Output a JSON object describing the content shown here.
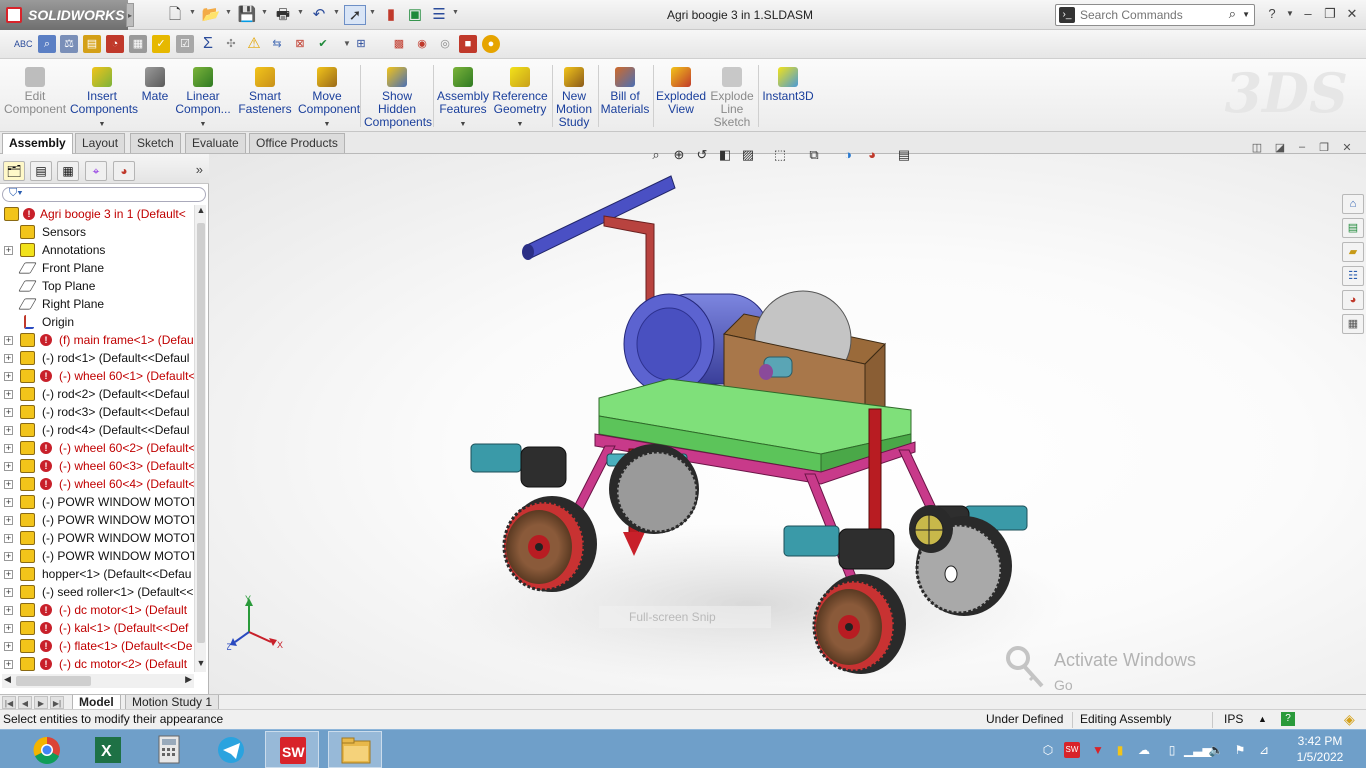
{
  "app": {
    "brand": "SOLIDWORKS",
    "document_title": "Agri boogie 3 in 1.SLDASM"
  },
  "search": {
    "placeholder": "Search Commands"
  },
  "command_manager": {
    "commands": [
      {
        "label": "Edit Component",
        "disabled": true
      },
      {
        "label": "Insert Components"
      },
      {
        "label": "Mate"
      },
      {
        "label": "Linear Compon..."
      },
      {
        "label": "Smart Fasteners"
      },
      {
        "label": "Move Component"
      },
      {
        "label": "Show Hidden Components"
      },
      {
        "label": "Assembly Features"
      },
      {
        "label": "Reference Geometry"
      },
      {
        "label": "New Motion Study"
      },
      {
        "label": "Bill of Materials"
      },
      {
        "label": "Exploded View"
      },
      {
        "label": "Explode Line Sketch",
        "disabled": true
      },
      {
        "label": "Instant3D"
      }
    ],
    "tabs": [
      "Assembly",
      "Layout",
      "Sketch",
      "Evaluate",
      "Office Products"
    ],
    "active_tab": "Assembly"
  },
  "feature_tree": {
    "items": [
      {
        "label": "Agri boogie 3 in 1  (Default<",
        "type": "root",
        "error": true
      },
      {
        "label": "Sensors",
        "type": "folder"
      },
      {
        "label": "Annotations",
        "type": "annotation",
        "expandable": true
      },
      {
        "label": "Front Plane",
        "type": "plane"
      },
      {
        "label": "Top Plane",
        "type": "plane"
      },
      {
        "label": "Right Plane",
        "type": "plane"
      },
      {
        "label": "Origin",
        "type": "origin"
      },
      {
        "label": "(f) main frame<1> (Defau",
        "type": "part",
        "error": true
      },
      {
        "label": "(-) rod<1> (Default<<Defaul",
        "type": "part"
      },
      {
        "label": "(-) wheel 60<1> (Default<",
        "type": "part",
        "error": true
      },
      {
        "label": "(-) rod<2> (Default<<Defaul",
        "type": "part"
      },
      {
        "label": "(-) rod<3> (Default<<Defaul",
        "type": "part"
      },
      {
        "label": "(-) rod<4> (Default<<Defaul",
        "type": "part"
      },
      {
        "label": "(-) wheel 60<2> (Default<",
        "type": "part",
        "error": true
      },
      {
        "label": "(-) wheel 60<3> (Default<",
        "type": "part",
        "error": true
      },
      {
        "label": "(-) wheel 60<4> (Default<",
        "type": "part",
        "error": true
      },
      {
        "label": "(-) POWR WINDOW MOTOT",
        "type": "part"
      },
      {
        "label": "(-) POWR WINDOW MOTOT",
        "type": "part"
      },
      {
        "label": "(-) POWR WINDOW MOTOT",
        "type": "part"
      },
      {
        "label": "(-) POWR WINDOW MOTOT",
        "type": "part"
      },
      {
        "label": "hopper<1> (Default<<Defau",
        "type": "part"
      },
      {
        "label": "(-) seed roller<1> (Default<<",
        "type": "part"
      },
      {
        "label": "(-) dc motor<1> (Default",
        "type": "part",
        "error": true
      },
      {
        "label": "(-) kal<1> (Default<<Def",
        "type": "part",
        "error": true
      },
      {
        "label": "(-) flate<1> (Default<<De",
        "type": "part",
        "error": true
      },
      {
        "label": "(-) dc motor<2> (Default",
        "type": "part",
        "error": true
      }
    ]
  },
  "viewport": {
    "snip_text": "Full-screen Snip",
    "activation": {
      "title": "Activate Windows",
      "subtitle": "Go to PC settings to activate Windows."
    },
    "triad_labels": {
      "x": "X",
      "y": "Y",
      "z": "Z"
    }
  },
  "bottom_tabs": {
    "items": [
      "Model",
      "Motion Study 1"
    ],
    "active": "Model"
  },
  "status_bar": {
    "message": "Select entities to modify their appearance",
    "state": "Under Defined",
    "mode": "Editing Assembly",
    "units": "IPS"
  },
  "taskbar": {
    "apps": [
      "chrome",
      "excel",
      "calculator",
      "telegram",
      "solidworks",
      "file-explorer"
    ],
    "active_app": "solidworks",
    "time": "3:42 PM",
    "date": "1/5/2022"
  },
  "colors": {
    "error_red": "#c8202a",
    "command_text": "#1a3f9c",
    "taskbar_blue": "#6f9fc9",
    "tree_error_text": "#c00000"
  }
}
